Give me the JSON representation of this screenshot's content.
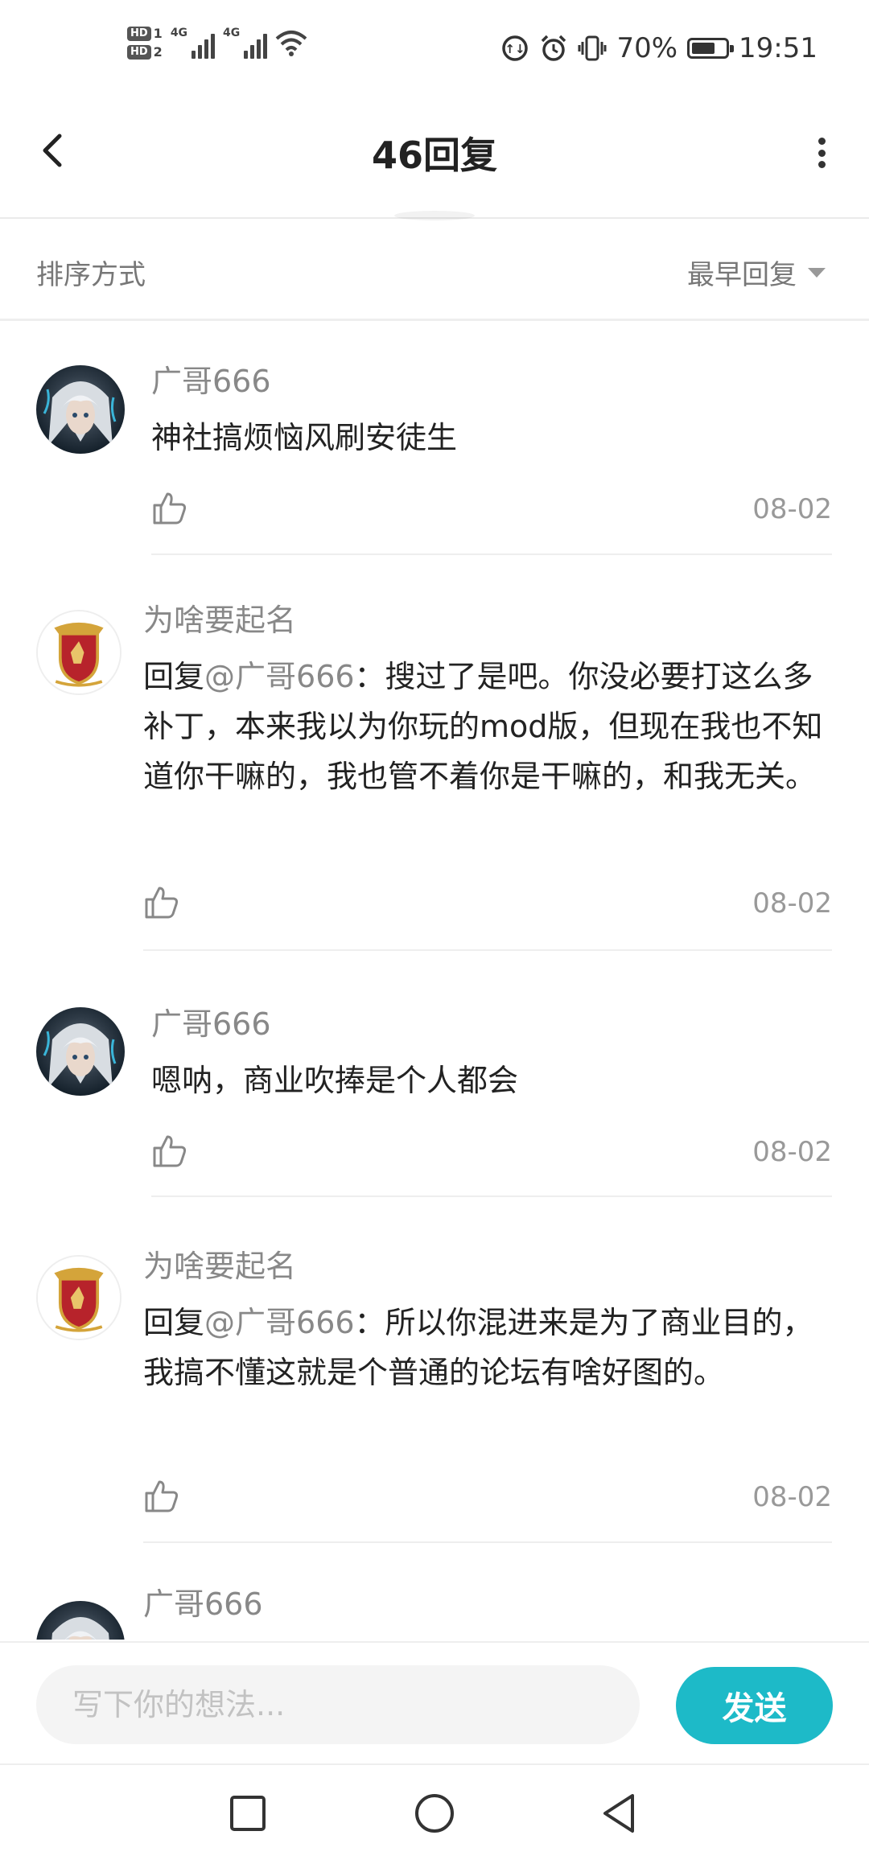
{
  "status_bar": {
    "sim1_badge": "HD",
    "sim1_num": "1",
    "sim2_badge": "HD",
    "sim2_num": "2",
    "net1": "4G",
    "net2": "4G",
    "battery": "70%",
    "battery_level": 0.7,
    "time": "19:51"
  },
  "header": {
    "title": "46回复"
  },
  "sort": {
    "label": "排序方式",
    "selected": "最早回复"
  },
  "comments": [
    {
      "author": "广哥666",
      "prefix": "",
      "mention": "",
      "text": "神社搞烦恼风刷安徒生",
      "date": "08-02",
      "avatar": "anime-avatar"
    },
    {
      "author": "为啥要起名",
      "prefix": "回复",
      "mention": "@广哥666",
      "text": "：搜过了是吧。你没必要打这么多补丁，本来我以为你玩的mod版，但现在我也不知道你干嘛的，我也管不着你是干嘛的，和我无关。",
      "date": "08-02",
      "avatar": "crest-avatar"
    },
    {
      "author": "广哥666",
      "prefix": "",
      "mention": "",
      "text": "嗯呐，商业吹捧是个人都会",
      "date": "08-02",
      "avatar": "anime-avatar"
    },
    {
      "author": "为啥要起名",
      "prefix": "回复",
      "mention": "@广哥666",
      "text": "：所以你混进来是为了商业目的，我搞不懂这就是个普通的论坛有啥好图的。",
      "date": "08-02",
      "avatar": "crest-avatar"
    },
    {
      "author": "广哥666",
      "prefix": "",
      "mention": "",
      "text": "",
      "date": "",
      "avatar": "anime-avatar"
    }
  ],
  "input": {
    "placeholder": "写下你的想法...",
    "value": "",
    "send_label": "发送"
  },
  "colors": {
    "accent": "#1dbac8",
    "text": "#222222",
    "muted": "#888888"
  }
}
